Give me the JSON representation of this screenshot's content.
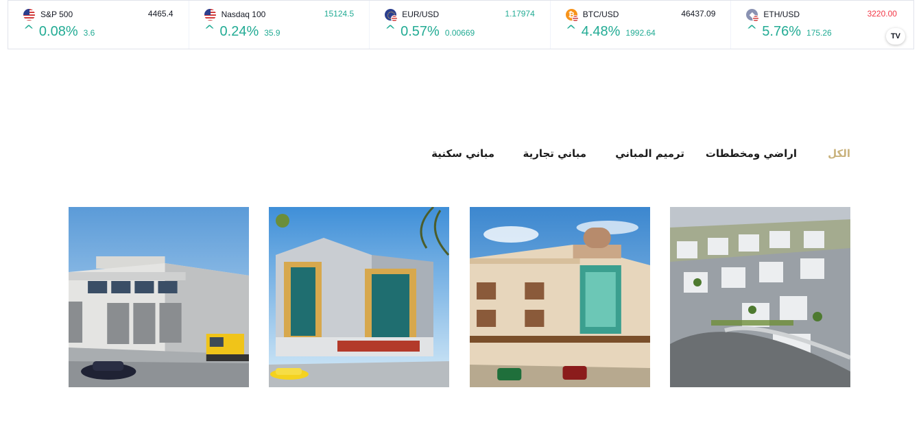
{
  "ticker": {
    "items": [
      {
        "symbol": "S&P 500",
        "price": "4465.4",
        "change_pct": "0.08%",
        "change": "3.6",
        "icon": "us-flag-icon",
        "price_color": "dark"
      },
      {
        "symbol": "Nasdaq 100",
        "price": "15124.5",
        "change_pct": "0.24%",
        "change": "35.9",
        "icon": "us-flag-icon",
        "price_color": "green"
      },
      {
        "symbol": "EUR/USD",
        "price": "1.17974",
        "change_pct": "0.57%",
        "change": "0.00669",
        "icon": "eu-us-flag-icon",
        "price_color": "green"
      },
      {
        "symbol": "BTC/USD",
        "price": "46437.09",
        "change_pct": "4.48%",
        "change": "1992.64",
        "icon": "bitcoin-icon",
        "price_color": "dark"
      },
      {
        "symbol": "ETH/USD",
        "price": "3220.00",
        "change_pct": "5.76%",
        "change": "175.26",
        "icon": "ethereum-icon",
        "price_color": "red"
      }
    ],
    "up_glyph": "^",
    "logo_text": "TV"
  },
  "colors": {
    "up": "#22ab94",
    "down": "#f23645",
    "active_filter": "#c9b27c",
    "text": "#1a1a1a"
  },
  "filters": {
    "items": [
      {
        "label": "الكل",
        "active": true
      },
      {
        "label": "اراضي ومخططات",
        "active": false
      },
      {
        "label": "ترميم المباني",
        "active": false
      },
      {
        "label": "مباني تجارية",
        "active": false
      },
      {
        "label": "مباني سكنية",
        "active": false
      }
    ]
  },
  "gallery": {
    "items": [
      {
        "subject": "warehouse-building-image"
      },
      {
        "subject": "commercial-tower-image"
      },
      {
        "subject": "residential-building-image"
      },
      {
        "subject": "villas-compound-image"
      }
    ]
  }
}
